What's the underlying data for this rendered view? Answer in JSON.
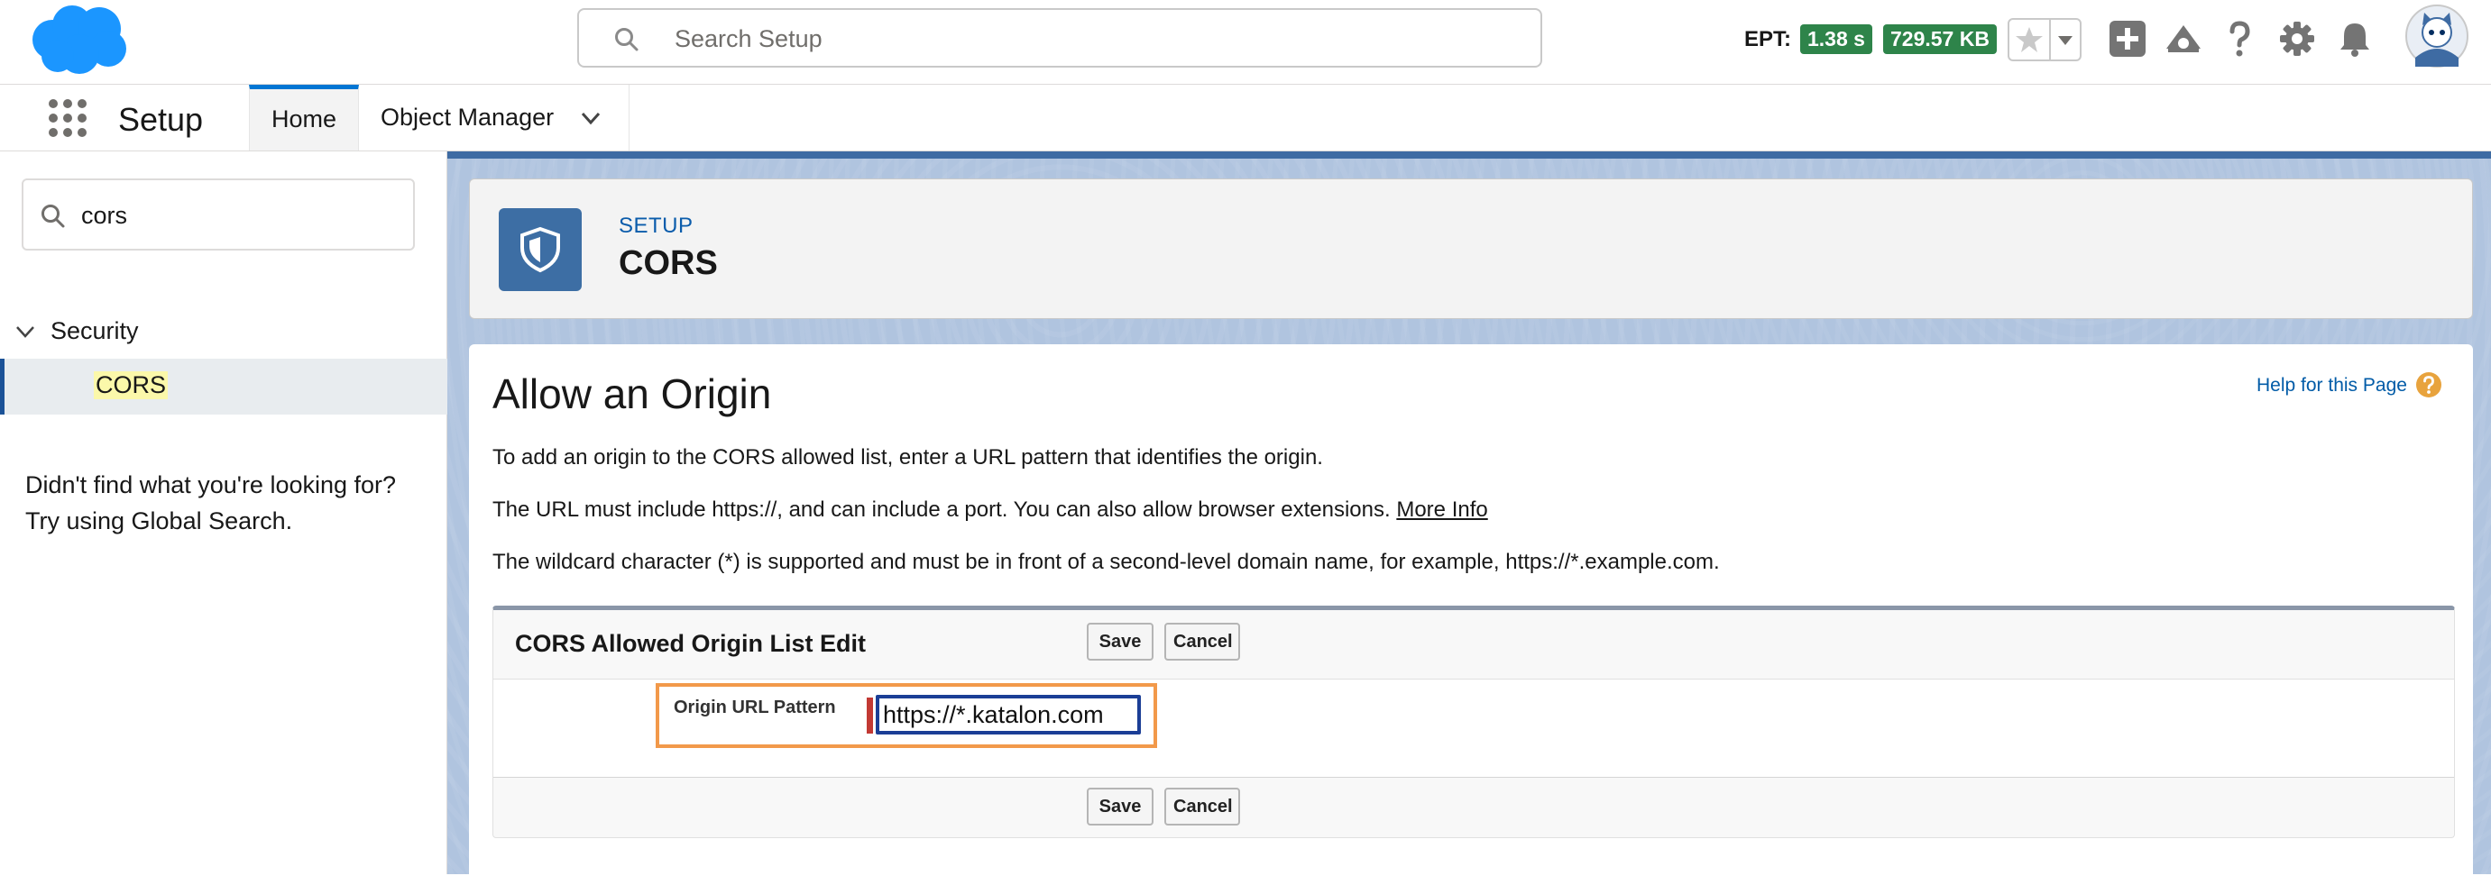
{
  "header": {
    "search_placeholder": "Search Setup",
    "ept_label": "EPT:",
    "ept_time": "1.38 s",
    "ept_size": "729.57 KB",
    "icons": [
      "salesforce-logo",
      "search-icon",
      "star-icon",
      "chevron-down-icon",
      "add-icon",
      "trailhead-icon",
      "help-icon",
      "gear-icon",
      "bell-icon",
      "avatar"
    ],
    "badge_color": "#2e844a"
  },
  "context_bar": {
    "app_name": "Setup",
    "tabs": [
      {
        "label": "Home",
        "active": true
      },
      {
        "label": "Object Manager",
        "active": false
      }
    ]
  },
  "sidebar": {
    "quickfind_value": "cors",
    "tree": {
      "section_label": "Security",
      "item_label": "CORS"
    },
    "not_found_line1": "Didn't find what you're looking for?",
    "not_found_line2": "Try using Global Search."
  },
  "page_header": {
    "eyebrow": "SETUP",
    "title": "CORS",
    "icon": "shield-icon"
  },
  "content": {
    "title": "Allow an Origin",
    "help_link": "Help for this Page",
    "para1": "To add an origin to the CORS allowed list, enter a URL pattern that identifies the origin.",
    "para2_text": "The URL must include https://, and can include a port. You can also allow browser extensions.",
    "para2_link": "More Info",
    "para3": "The wildcard character (*) is supported and must be in front of a second-level domain name, for example, https://*.example.com.",
    "edit_block": {
      "title": "CORS Allowed Origin List Edit",
      "save_label": "Save",
      "cancel_label": "Cancel",
      "field_label": "Origin URL Pattern",
      "field_value": "https://*.katalon.com"
    }
  }
}
